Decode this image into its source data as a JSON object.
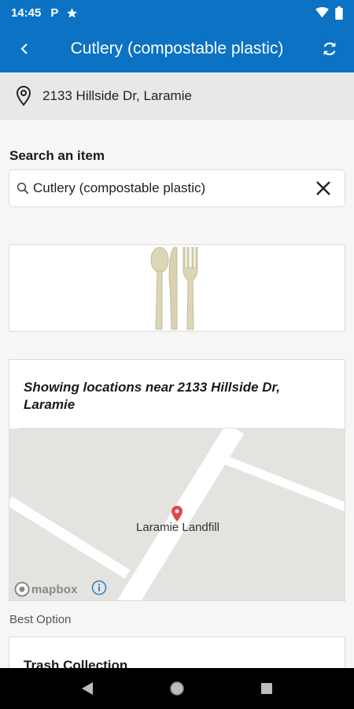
{
  "status_bar": {
    "time": "14:45",
    "left_icons": [
      "parking-icon",
      "star-icon"
    ],
    "right_icons": [
      "wifi-icon",
      "battery-icon"
    ]
  },
  "app_bar": {
    "title": "Cutlery (compostable plastic)",
    "back_icon": "back-chevron-icon",
    "refresh_icon": "refresh-icon"
  },
  "address": {
    "icon": "location-pin-icon",
    "text": "2133 Hillside Dr, Laramie"
  },
  "search": {
    "label": "Search an item",
    "value": "Cutlery (compostable plastic)",
    "search_icon": "search-icon",
    "clear_icon": "close-icon"
  },
  "item_image": {
    "icon": "cutlery-icon"
  },
  "map": {
    "heading": "Showing locations near 2133 Hillside Dr, Laramie",
    "marker_label": "Laramie Landfill",
    "attribution": "mapbox"
  },
  "results": {
    "best_label": "Best Option",
    "best_title": "Trash Collection"
  },
  "nav": {
    "icons": [
      "back-triangle-icon",
      "home-circle-icon",
      "recents-square-icon"
    ]
  },
  "colors": {
    "primary": "#0b72c4",
    "pin": "#e5484d"
  }
}
